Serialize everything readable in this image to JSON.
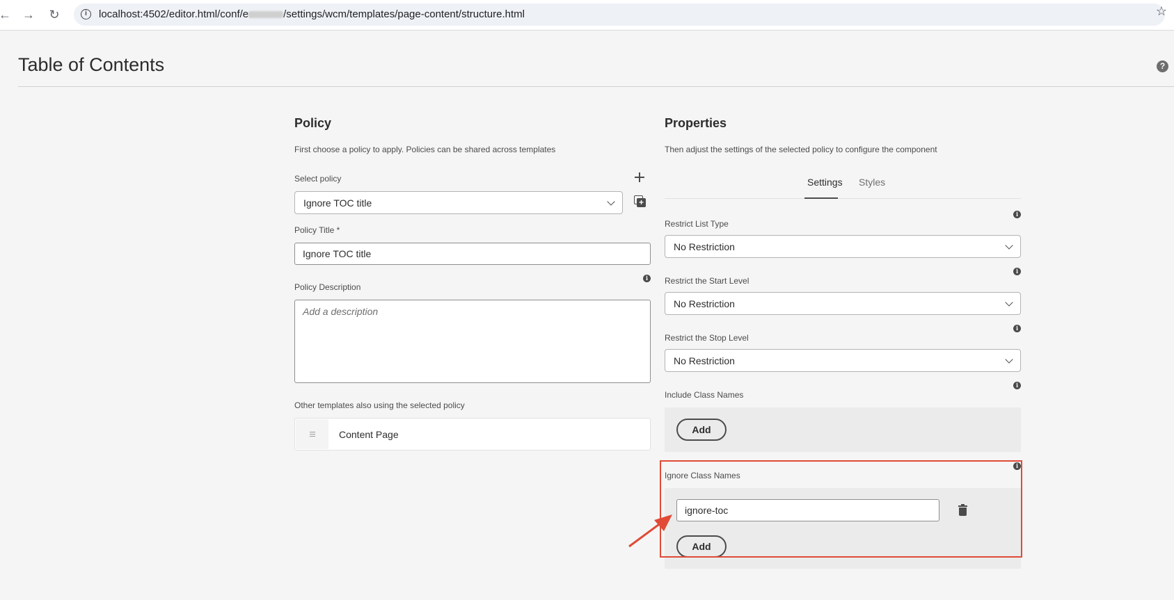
{
  "browser": {
    "url_prefix": "localhost:4502/editor.html/conf/",
    "url_redacted": "e",
    "url_suffix": "/settings/wcm/templates/page-content/structure.html",
    "back_icon": "arrow-left-icon",
    "forward_icon": "arrow-right-icon",
    "reload_icon": "reload-icon",
    "info_icon": "info-icon",
    "bookmark_icon": "star-icon"
  },
  "page": {
    "title": "Table of Contents",
    "help_icon": "?"
  },
  "policy": {
    "heading": "Policy",
    "description": "First choose a policy to apply. Policies can be shared across templates",
    "select_label": "Select policy",
    "select_value": "Ignore TOC title",
    "title_label": "Policy Title *",
    "title_value": "Ignore TOC title",
    "description_label": "Policy Description",
    "description_placeholder": "Add a description",
    "other_templates_label": "Other templates also using the selected policy",
    "templates": [
      {
        "name": "Content Page"
      }
    ]
  },
  "properties": {
    "heading": "Properties",
    "description": "Then adjust the settings of the selected policy to configure the component",
    "tabs": [
      {
        "label": "Settings",
        "active": true
      },
      {
        "label": "Styles",
        "active": false
      }
    ],
    "restrict_list_type": {
      "label": "Restrict List Type",
      "value": "No Restriction"
    },
    "restrict_start_level": {
      "label": "Restrict the Start Level",
      "value": "No Restriction"
    },
    "restrict_stop_level": {
      "label": "Restrict the Stop Level",
      "value": "No Restriction"
    },
    "include_class_names": {
      "label": "Include Class Names",
      "add_label": "Add"
    },
    "ignore_class_names": {
      "label": "Ignore Class Names",
      "items": [
        "ignore-toc"
      ],
      "add_label": "Add"
    }
  },
  "annotation": {
    "highlight_color": "#e04a36"
  }
}
